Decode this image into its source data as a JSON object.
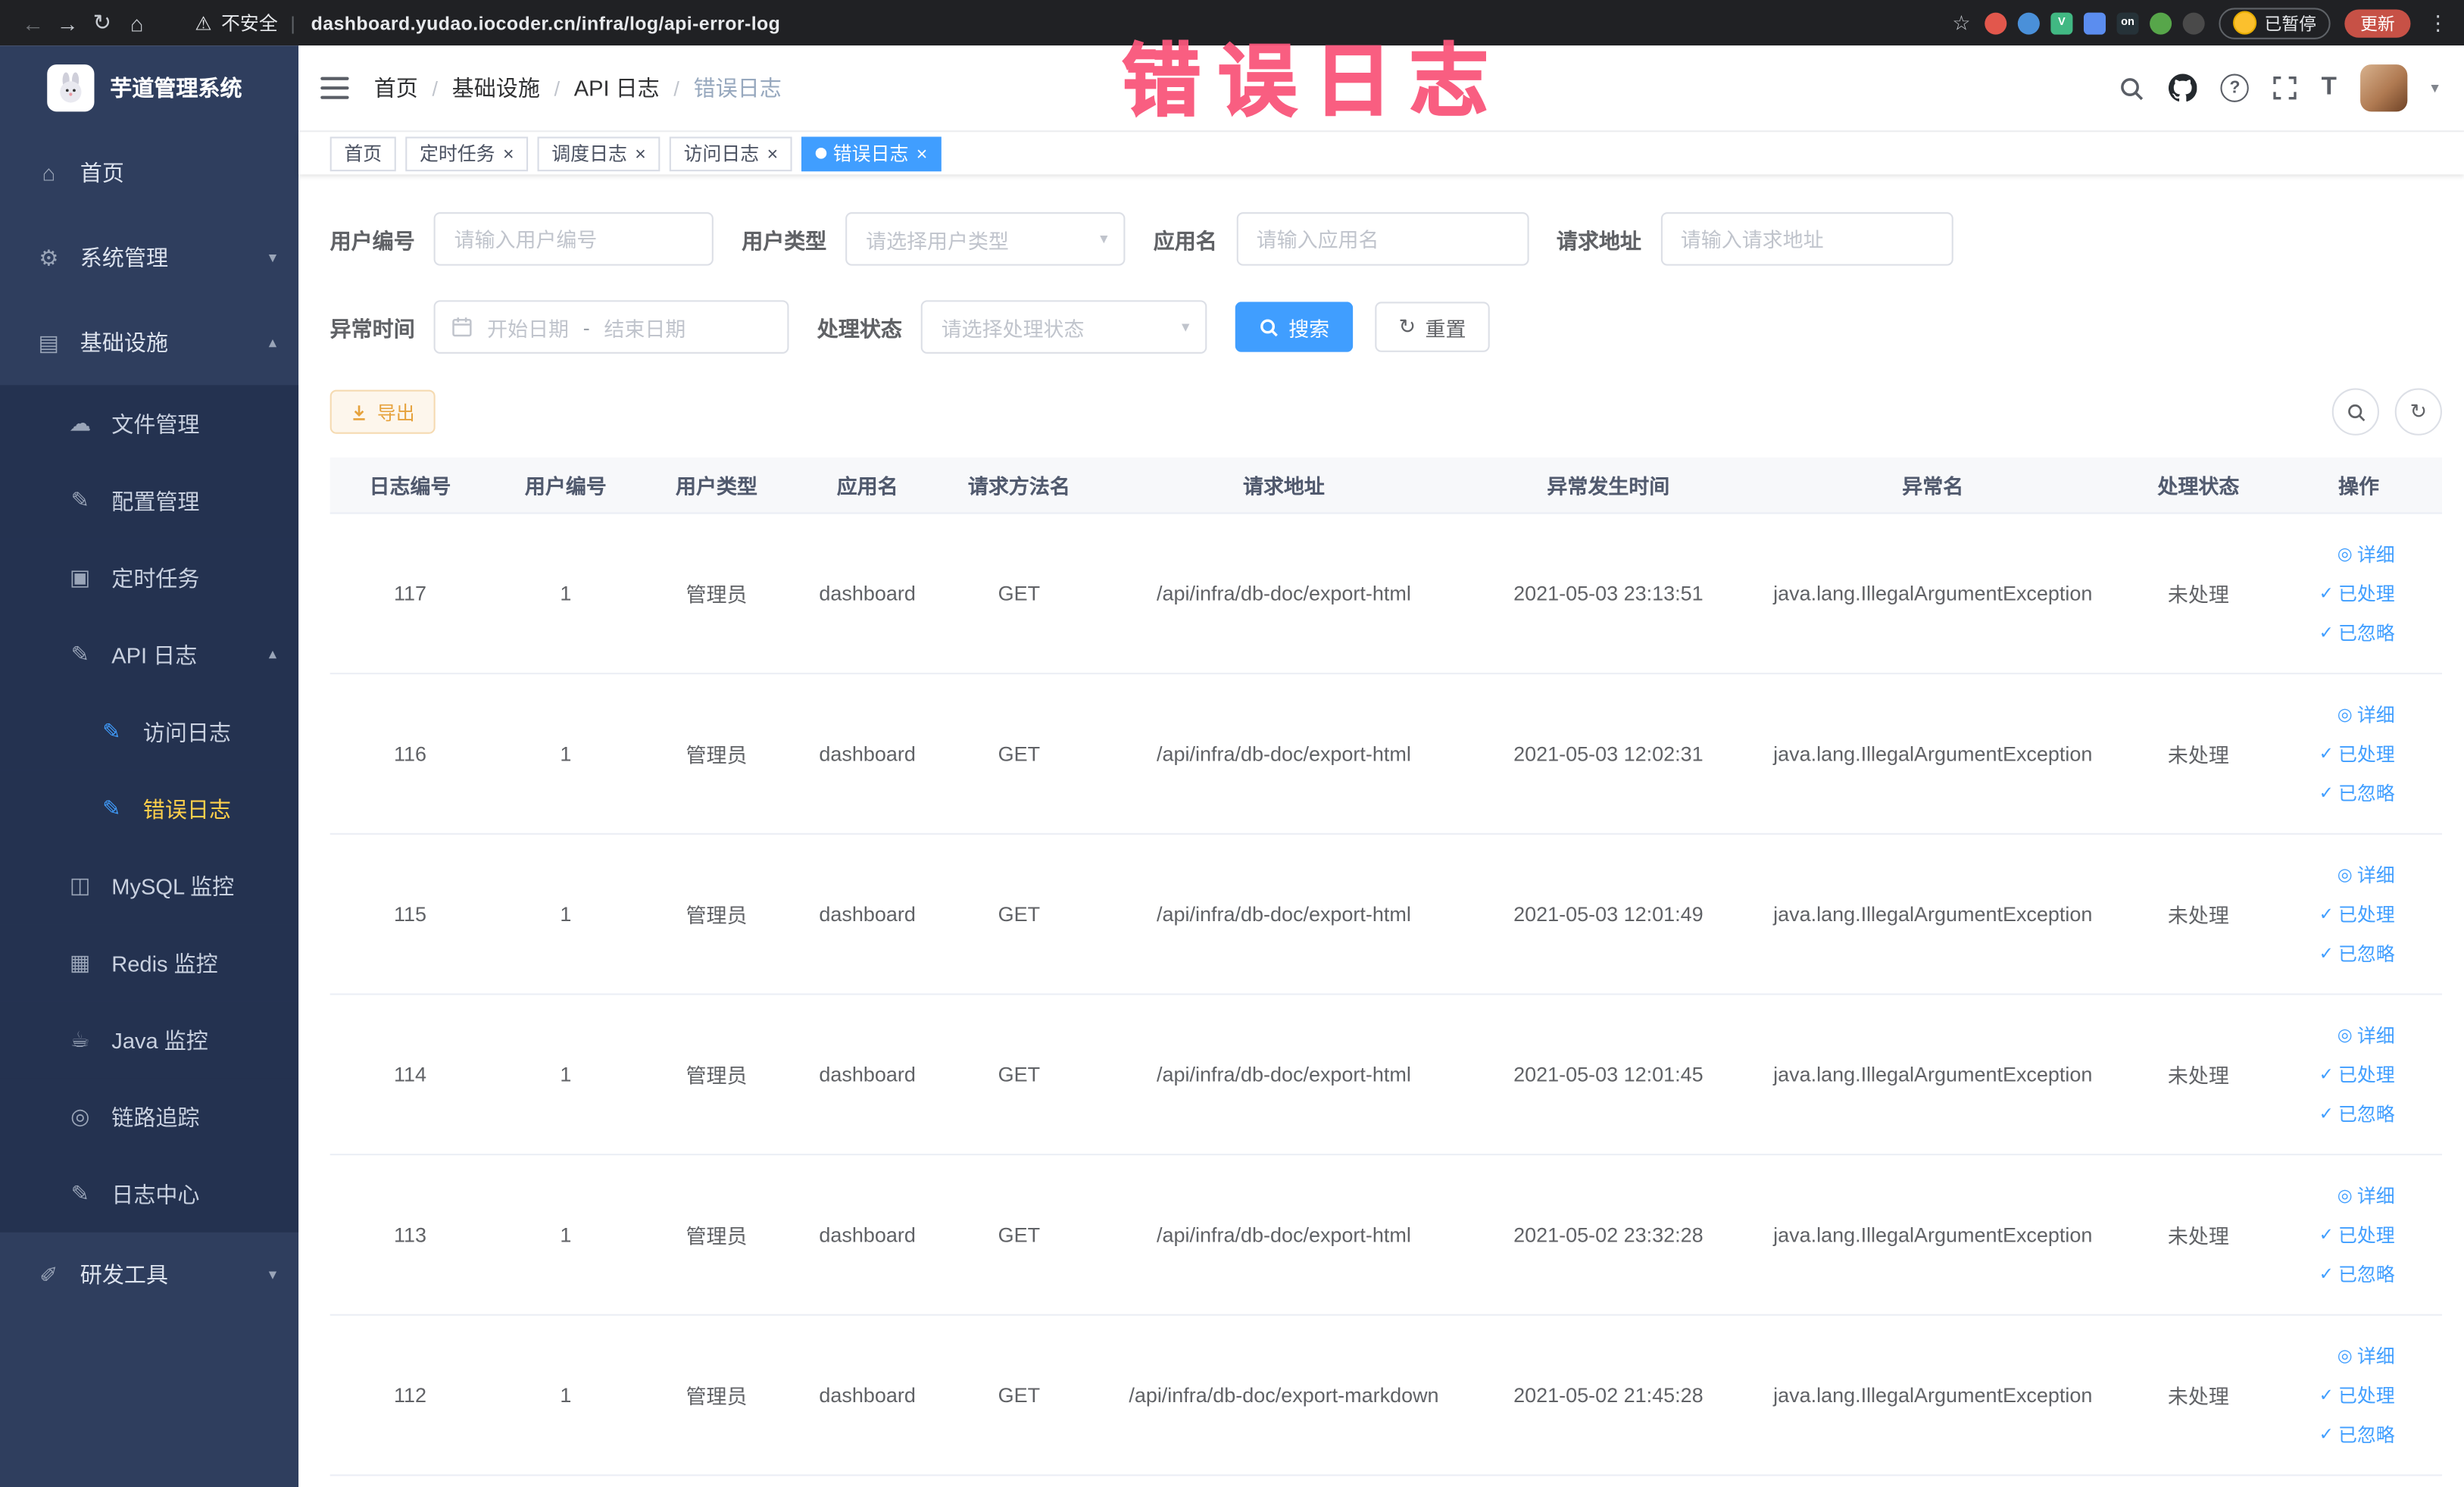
{
  "browser": {
    "security_label": "不安全",
    "url": "dashboard.yudao.iocoder.cn/infra/log/api-error-log",
    "paused_badge": "已暂停",
    "update_button": "更新",
    "profile_avatar_color": "#fbc02d",
    "extensions": [
      {
        "name": "extension-red-circle-icon",
        "color": "#e2574c",
        "shape": "circle",
        "glyph": ""
      },
      {
        "name": "extension-blue-drop-icon",
        "color": "#4a90d9",
        "shape": "circle",
        "glyph": ""
      },
      {
        "name": "extension-vue-devtools-icon",
        "color": "#41b883",
        "shape": "square",
        "glyph": "V"
      },
      {
        "name": "extension-blue-grid-icon",
        "color": "#5b8def",
        "shape": "square",
        "glyph": ""
      },
      {
        "name": "extension-on-badge-icon",
        "color": "#263238",
        "shape": "square",
        "glyph": "on"
      },
      {
        "name": "extension-green-leaf-icon",
        "color": "#57a64a",
        "shape": "circle",
        "glyph": ""
      },
      {
        "name": "extension-dark-paw-icon",
        "color": "#4a4a4a",
        "shape": "circle",
        "glyph": ""
      }
    ]
  },
  "annotation": "错误日志",
  "sidebar": {
    "app_title": "芋道管理系统",
    "items": {
      "home": "首页",
      "system": "系统管理",
      "infra": "基础设施",
      "file": "文件管理",
      "config": "配置管理",
      "job": "定时任务",
      "api_log": "API 日志",
      "access_log": "访问日志",
      "error_log": "错误日志",
      "mysql": "MySQL 监控",
      "redis": "Redis 监控",
      "java": "Java 监控",
      "trace": "链路追踪",
      "log_center": "日志中心",
      "dev_tools": "研发工具"
    }
  },
  "header": {
    "breadcrumb": [
      "首页",
      "基础设施",
      "API 日志",
      "错误日志"
    ]
  },
  "tabs": [
    {
      "label": "首页"
    },
    {
      "label": "定时任务"
    },
    {
      "label": "调度日志"
    },
    {
      "label": "访问日志"
    },
    {
      "label": "错误日志"
    }
  ],
  "filters": {
    "user_id": {
      "label": "用户编号",
      "placeholder": "请输入用户编号"
    },
    "user_type": {
      "label": "用户类型",
      "placeholder": "请选择用户类型"
    },
    "app_name": {
      "label": "应用名",
      "placeholder": "请输入应用名"
    },
    "request_url": {
      "label": "请求地址",
      "placeholder": "请输入请求地址"
    },
    "exception_time": {
      "label": "异常时间",
      "start_placeholder": "开始日期",
      "separator": "-",
      "end_placeholder": "结束日期"
    },
    "process_status": {
      "label": "处理状态",
      "placeholder": "请选择处理状态"
    },
    "search_button": "搜索",
    "reset_button": "重置"
  },
  "toolbar": {
    "export_button": "导出"
  },
  "table": {
    "columns": [
      "日志编号",
      "用户编号",
      "用户类型",
      "应用名",
      "请求方法名",
      "请求地址",
      "异常发生时间",
      "异常名",
      "处理状态",
      "操作"
    ],
    "row_actions": [
      "详细",
      "已处理",
      "已忽略"
    ],
    "rows": [
      {
        "log_id": "117",
        "user_id": "1",
        "user_type": "管理员",
        "app_name": "dashboard",
        "method": "GET",
        "url": "/api/infra/db-doc/export-html",
        "time": "2021-05-03 23:13:51",
        "exception": "java.lang.IllegalArgumentException",
        "status": "未处理"
      },
      {
        "log_id": "116",
        "user_id": "1",
        "user_type": "管理员",
        "app_name": "dashboard",
        "method": "GET",
        "url": "/api/infra/db-doc/export-html",
        "time": "2021-05-03 12:02:31",
        "exception": "java.lang.IllegalArgumentException",
        "status": "未处理"
      },
      {
        "log_id": "115",
        "user_id": "1",
        "user_type": "管理员",
        "app_name": "dashboard",
        "method": "GET",
        "url": "/api/infra/db-doc/export-html",
        "time": "2021-05-03 12:01:49",
        "exception": "java.lang.IllegalArgumentException",
        "status": "未处理"
      },
      {
        "log_id": "114",
        "user_id": "1",
        "user_type": "管理员",
        "app_name": "dashboard",
        "method": "GET",
        "url": "/api/infra/db-doc/export-html",
        "time": "2021-05-03 12:01:45",
        "exception": "java.lang.IllegalArgumentException",
        "status": "未处理"
      },
      {
        "log_id": "113",
        "user_id": "1",
        "user_type": "管理员",
        "app_name": "dashboard",
        "method": "GET",
        "url": "/api/infra/db-doc/export-html",
        "time": "2021-05-02 23:32:28",
        "exception": "java.lang.IllegalArgumentException",
        "status": "未处理"
      },
      {
        "log_id": "112",
        "user_id": "1",
        "user_type": "管理员",
        "app_name": "dashboard",
        "method": "GET",
        "url": "/api/infra/db-doc/export-markdown",
        "time": "2021-05-02 21:45:28",
        "exception": "java.lang.IllegalArgumentException",
        "status": "未处理"
      }
    ]
  },
  "colors": {
    "accent": "#409EFF",
    "active_tab_bg": "#409EFF",
    "sidebar_bg": "#2f3e5e",
    "sidebar_submenu_bg": "#243250",
    "sidebar_active_text": "#ffd04b",
    "annotation_pink": "#f9567b",
    "warning_button_bg": "#fdf6ec",
    "warning_button_border": "#f5dab1",
    "warning_button_text": "#e6a23c",
    "chrome_bg": "#202124",
    "update_button_bg": "#c75146",
    "table_header_bg": "#f7f8fa"
  }
}
